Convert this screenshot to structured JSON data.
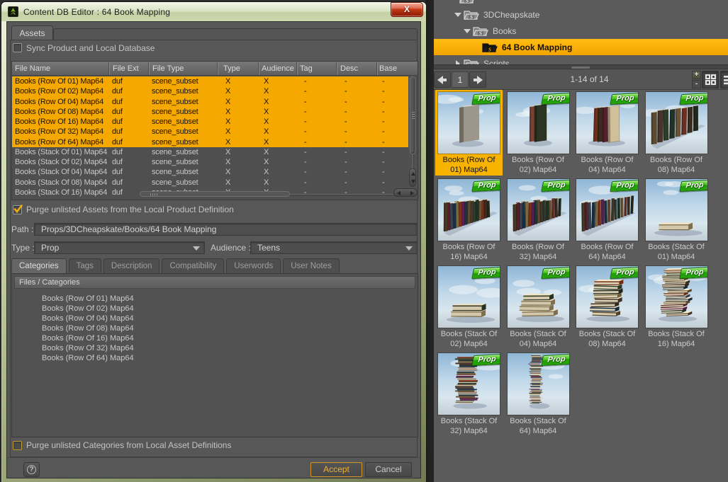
{
  "colors": {
    "selection_amber": "#f5a800",
    "tree_selection_amber": "#f8ac00",
    "tile_selection_amber": "#f8b300",
    "badge_green": "#2aa50d",
    "panel_grey": "#5b5b5b",
    "dialog_grey": "#575757"
  },
  "dialog": {
    "title": "Content DB Editor : 64 Book Mapping",
    "close_label": "X",
    "assets_tab_label": "Assets",
    "sync_checkbox": {
      "label": "Sync Product and Local Database",
      "checked": false
    },
    "table": {
      "columns": [
        "File Name",
        "File Ext",
        "File Type",
        "Type",
        "Audience",
        "Tag",
        "Desc",
        "Base"
      ],
      "rows": [
        {
          "selected": true,
          "cells": [
            "Books (Row Of 01) Map64",
            "duf",
            "scene_subset",
            "X",
            "X",
            "-",
            "-",
            "-"
          ]
        },
        {
          "selected": true,
          "cells": [
            "Books (Row Of 02) Map64",
            "duf",
            "scene_subset",
            "X",
            "X",
            "-",
            "-",
            "-"
          ]
        },
        {
          "selected": true,
          "cells": [
            "Books (Row Of 04) Map64",
            "duf",
            "scene_subset",
            "X",
            "X",
            "-",
            "-",
            "-"
          ]
        },
        {
          "selected": true,
          "cells": [
            "Books (Row Of 08) Map64",
            "duf",
            "scene_subset",
            "X",
            "X",
            "-",
            "-",
            "-"
          ]
        },
        {
          "selected": true,
          "cells": [
            "Books (Row Of 16) Map64",
            "duf",
            "scene_subset",
            "X",
            "X",
            "-",
            "-",
            "-"
          ]
        },
        {
          "selected": true,
          "cells": [
            "Books (Row Of 32) Map64",
            "duf",
            "scene_subset",
            "X",
            "X",
            "-",
            "-",
            "-"
          ]
        },
        {
          "selected": true,
          "cells": [
            "Books (Row Of 64) Map64",
            "duf",
            "scene_subset",
            "X",
            "X",
            "-",
            "-",
            "-"
          ]
        },
        {
          "selected": false,
          "cells": [
            "Books (Stack Of 01) Map64",
            "duf",
            "scene_subset",
            "X",
            "X",
            "-",
            "-",
            "-"
          ]
        },
        {
          "selected": false,
          "cells": [
            "Books (Stack Of 02) Map64",
            "duf",
            "scene_subset",
            "X",
            "X",
            "-",
            "-",
            "-"
          ]
        },
        {
          "selected": false,
          "cells": [
            "Books (Stack Of 04) Map64",
            "duf",
            "scene_subset",
            "X",
            "X",
            "-",
            "-",
            "-"
          ]
        },
        {
          "selected": false,
          "cells": [
            "Books (Stack Of 08) Map64",
            "duf",
            "scene_subset",
            "X",
            "X",
            "-",
            "-",
            "-"
          ]
        },
        {
          "selected": false,
          "cells": [
            "Books (Stack Of 16) Map64",
            "duf",
            "scene_subset",
            "X",
            "X",
            "-",
            "-",
            "-"
          ]
        }
      ]
    },
    "purge_assets_checkbox": {
      "label": "Purge unlisted Assets from the Local Product Definition",
      "checked": true
    },
    "path_field": {
      "label": "Path :",
      "value": "Props/3DCheapskate/Books/64 Book Mapping"
    },
    "type_dropdown": {
      "label": "Type :",
      "value": "Prop"
    },
    "audience_dropdown": {
      "label": "Audience :",
      "value": "Teens"
    },
    "detail_tabs": [
      "Categories",
      "Tags",
      "Description",
      "Compatibility",
      "Userwords",
      "User Notes"
    ],
    "active_detail_tab": "Categories",
    "files_categories": {
      "header": "Files / Categories",
      "items": [
        "Books (Row Of 01) Map64",
        "Books (Row Of 02) Map64",
        "Books (Row Of 04) Map64",
        "Books (Row Of 08) Map64",
        "Books (Row Of 16) Map64",
        "Books (Row Of 32) Map64",
        "Books (Row Of 64) Map64"
      ]
    },
    "purge_categories_checkbox": {
      "label": "Purge unlisted Categories from Local Asset Definitions",
      "checked": false
    },
    "help_label": "?",
    "accept_label": "Accept",
    "cancel_label": "Cancel"
  },
  "browser": {
    "tree": [
      {
        "label": "",
        "depth": 1,
        "state": "partial-top",
        "selected": false
      },
      {
        "label": "3DCheapskate",
        "depth": 1,
        "state": "expanded",
        "selected": false
      },
      {
        "label": "Books",
        "depth": 2,
        "state": "expanded",
        "selected": false
      },
      {
        "label": "64 Book Mapping",
        "depth": 3,
        "state": "leaf",
        "selected": true
      },
      {
        "label": "Scripts",
        "depth": 1,
        "state": "collapsed",
        "selected": false
      }
    ],
    "pager": {
      "page": "1",
      "range_text": "1-14 of 14",
      "zoom_in": "+",
      "zoom_out": "-"
    },
    "tiles": [
      {
        "caption": "Books (Row Of\n01) Map64",
        "badge": "Prop",
        "selected": true,
        "art": {
          "kind": "row",
          "count": 1
        }
      },
      {
        "caption": "Books (Row Of\n02) Map64",
        "badge": "Prop",
        "selected": false,
        "art": {
          "kind": "row",
          "count": 2
        }
      },
      {
        "caption": "Books (Row Of\n04) Map64",
        "badge": "Prop",
        "selected": false,
        "art": {
          "kind": "row",
          "count": 4
        }
      },
      {
        "caption": "Books (Row Of\n08) Map64",
        "badge": "Prop",
        "selected": false,
        "art": {
          "kind": "row",
          "count": 8
        }
      },
      {
        "caption": "Books (Row Of\n16) Map64",
        "badge": "Prop",
        "selected": false,
        "art": {
          "kind": "row",
          "count": 16
        }
      },
      {
        "caption": "Books (Row Of\n32) Map64",
        "badge": "Prop",
        "selected": false,
        "art": {
          "kind": "row",
          "count": 32
        }
      },
      {
        "caption": "Books (Row Of\n64) Map64",
        "badge": "Prop",
        "selected": false,
        "art": {
          "kind": "row",
          "count": 64
        }
      },
      {
        "caption": "Books (Stack Of\n01) Map64",
        "badge": "Prop",
        "selected": false,
        "art": {
          "kind": "stack",
          "count": 1
        }
      },
      {
        "caption": "Books (Stack Of\n02) Map64",
        "badge": "Prop",
        "selected": false,
        "art": {
          "kind": "stack",
          "count": 2
        }
      },
      {
        "caption": "Books (Stack Of\n04) Map64",
        "badge": "Prop",
        "selected": false,
        "art": {
          "kind": "stack",
          "count": 4
        }
      },
      {
        "caption": "Books (Stack Of\n08) Map64",
        "badge": "Prop",
        "selected": false,
        "art": {
          "kind": "stack",
          "count": 8
        }
      },
      {
        "caption": "Books (Stack Of\n16) Map64",
        "badge": "Prop",
        "selected": false,
        "art": {
          "kind": "stack",
          "count": 16
        }
      },
      {
        "caption": "Books (Stack Of\n32) Map64",
        "badge": "Prop",
        "selected": false,
        "art": {
          "kind": "stack",
          "count": 32
        }
      },
      {
        "caption": "Books (Stack Of\n64) Map64",
        "badge": "Prop",
        "selected": false,
        "art": {
          "kind": "stack",
          "count": 64
        }
      }
    ]
  }
}
